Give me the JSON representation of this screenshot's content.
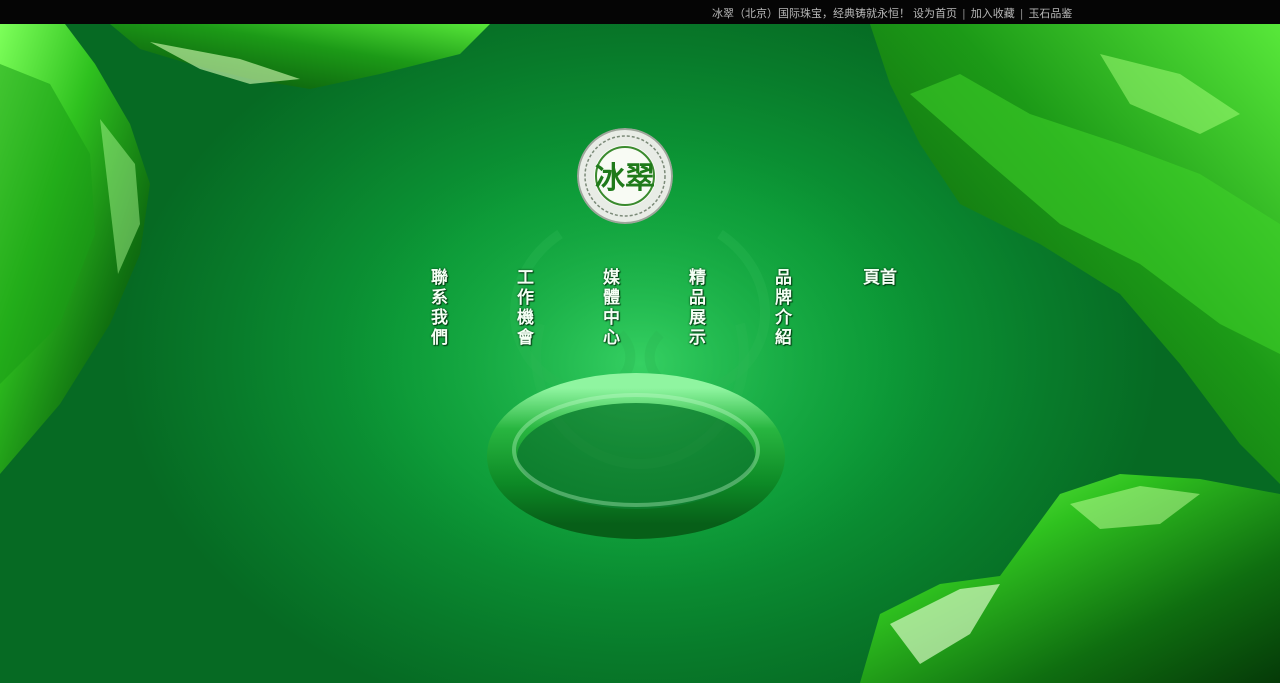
{
  "topbar": {
    "slogan": "冰翠（北京）国际珠宝，经典铸就永恒！",
    "links": [
      "设为首页",
      "加入收藏",
      "玉石品鉴"
    ],
    "separator": "|"
  },
  "logo": {
    "text": "冰翠"
  },
  "nav": {
    "home_top": "首",
    "home_bottom": "頁",
    "brand": "品牌介紹",
    "products": "精品展示",
    "media": "媒體中心",
    "jobs": "工作機會",
    "contact": "聯系我們"
  },
  "colors": {
    "background_green": "#0c9a37",
    "topbar": "#050505",
    "topbar_text": "#b8b8b8",
    "nav_text": "#f4fff4"
  }
}
